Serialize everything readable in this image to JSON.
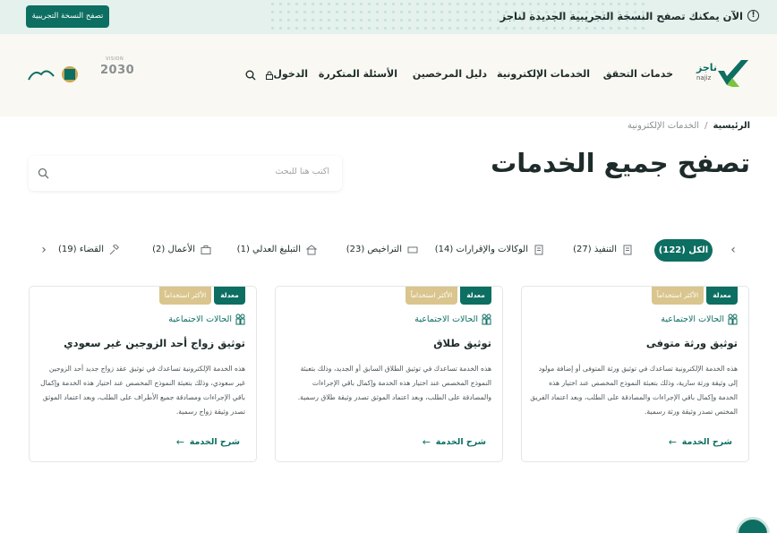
{
  "banner": {
    "text": "الآن يمكنك تصفح النسخة التجريبية الجديدة لناجز",
    "info_icon": "!",
    "trial_button": "تصفح النسخة التجريبية"
  },
  "header": {
    "logo_word": "ناجز",
    "logo_word_latin": "najiz",
    "nav": {
      "verification": "خدمات التحقق",
      "eservices": "الخدمات الإلكترونية",
      "licensees": "دليل المرخصين",
      "faq": "الأسئلة المتكررة",
      "login": "الدخول"
    },
    "vision_label": "VISION",
    "vision_number": "2030"
  },
  "breadcrumb": {
    "home": "الرئيسية",
    "separator": "/",
    "current": "الخدمات الإلكترونية"
  },
  "page_title": "تصفح جميع الخدمات",
  "search": {
    "placeholder": "اكتب هنا للبحث"
  },
  "filters": {
    "all": "الكل (122)",
    "execution": "التنفيذ (27)",
    "agencies": "الوكالات والإقرارات (14)",
    "licenses": "التراخيص (23)",
    "notification": "التبليغ العدلي (1)",
    "business": "الأعمال (2)",
    "judiciary": "القضاء (19)"
  },
  "cards": [
    {
      "badge_new": "معدلة",
      "badge_popular": "الأكثر استخداماً",
      "category": "الحالات الاجتماعية",
      "title": "توثيق ورثة متوفى",
      "description": "هذه الخدمة الإلكترونية تساعدك في توثيق ورثة المتوفى أو إضافة مولود إلى وثيقة ورثة سارية، وذلك بتعبئة النموذج المخصص عند اختيار هذه الخدمة وإكمال باقي الإجراءات والمصادقة على الطلب، وبعد اعتماد الفريق المختص تصدر وثيقة ورثة رسمية.",
      "link": "شرح الخدمة"
    },
    {
      "badge_new": "معدلة",
      "badge_popular": "الأكثر استخداماً",
      "category": "الحالات الاجتماعية",
      "title": "توثيق طلاق",
      "description": "هذه الخدمة تساعدك في توثيق الطلاق السابق أو الجديد، وذلك بتعبئة النموذج المخصص عند اختيار هذه الخدمة وإكمال باقي الإجراءات والمصادقة على الطلب، وبعد اعتماد الموثق تصدر وثيقة طلاق رسمية.",
      "link": "شرح الخدمة"
    },
    {
      "badge_new": "معدلة",
      "badge_popular": "الأكثر استخداماً",
      "category": "الحالات الاجتماعية",
      "title": "توثيق زواج أحد الزوجين غير سعودي",
      "description": "هذه الخدمة الإلكترونية تساعدك في توثيق عقد زواج جديد أحد الزوجين غير سعودي، وذلك بتعبئة النموذج المخصص عند اختيار هذه الخدمة وإكمال باقي الإجراءات ومصادقة جميع الأطراف على الطلب، وبعد اعتماد الموثق تصدر وثيقة زواج رسمية.",
      "link": "شرح الخدمة"
    }
  ],
  "colors": {
    "primary": "#0d6e62",
    "gold": "#d9c58d",
    "banner_bg": "#e4f1ec",
    "header_bg": "#f9f8f2"
  }
}
